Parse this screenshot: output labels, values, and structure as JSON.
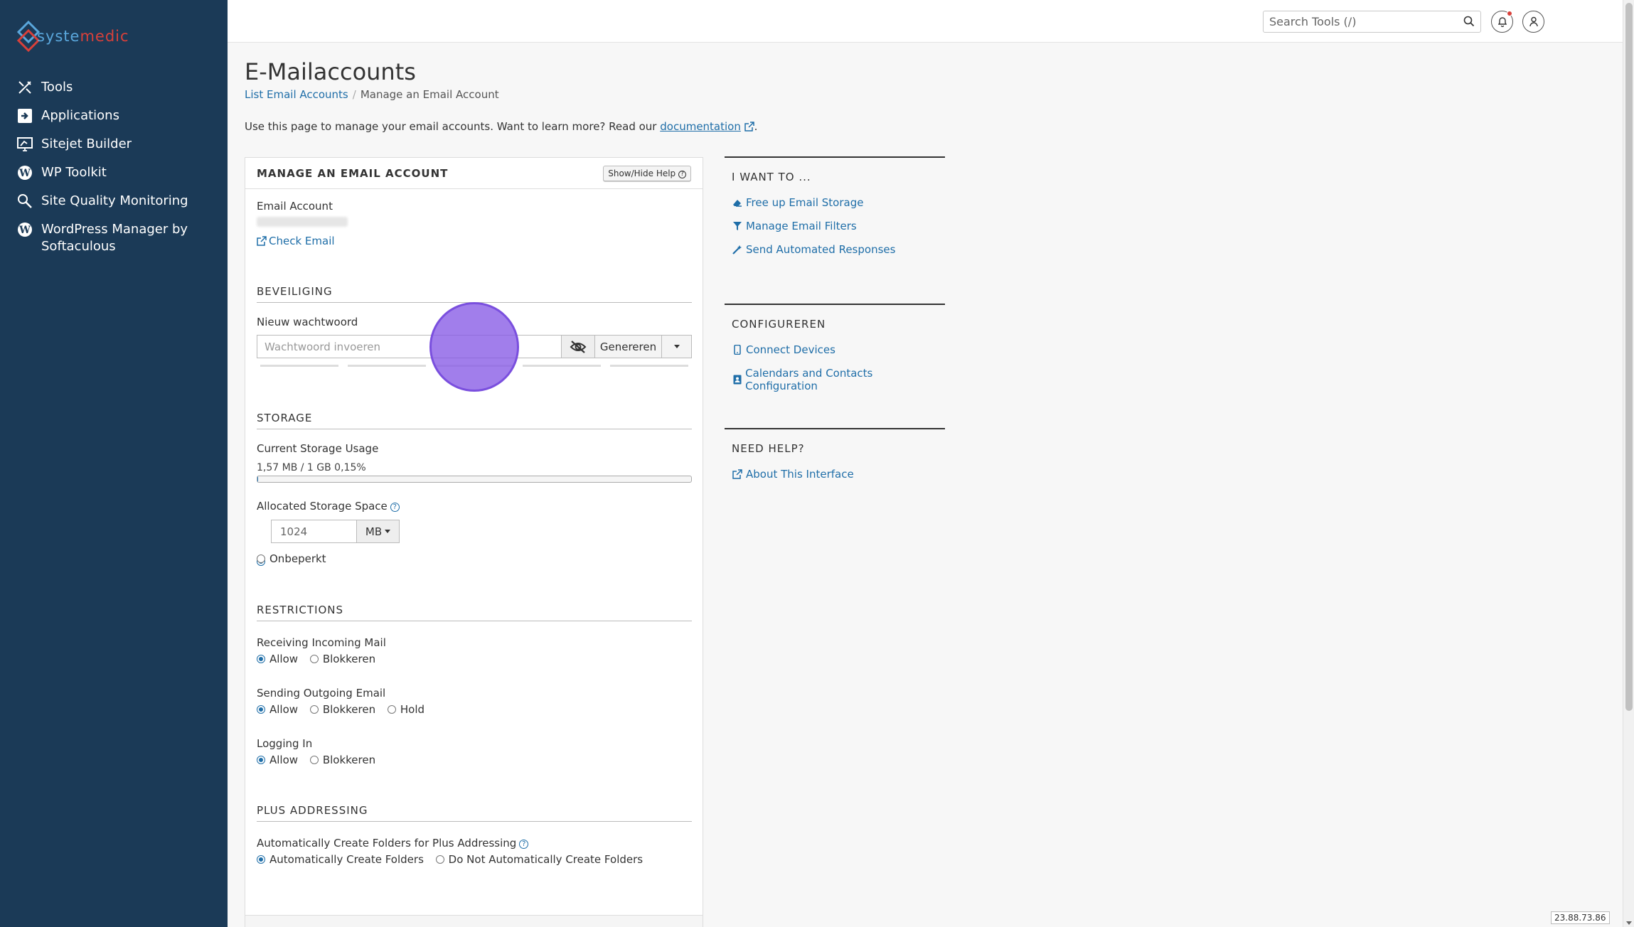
{
  "brand": {
    "logo_text_1": "syste",
    "logo_text_2": "medic",
    "accent": "#1f6ea8",
    "sidebar_bg": "#1b3a57"
  },
  "sidebar": {
    "items": [
      {
        "label": "Tools",
        "icon": "tools-icon"
      },
      {
        "label": "Applications",
        "icon": "applications-icon"
      },
      {
        "label": "Sitejet Builder",
        "icon": "sitejet-icon"
      },
      {
        "label": "WP Toolkit",
        "icon": "wordpress-icon"
      },
      {
        "label": "Site Quality Monitoring",
        "icon": "magnifier-icon"
      },
      {
        "label": "WordPress Manager by Softaculous",
        "icon": "wordpress-icon"
      }
    ]
  },
  "topbar": {
    "search_placeholder": "Search Tools (/)"
  },
  "page": {
    "title": "E-Mailaccounts",
    "breadcrumb": {
      "link": "List Email Accounts",
      "sep": "/",
      "current": "Manage an Email Account"
    },
    "intro_text": "Use this page to manage your email accounts. Want to learn more? Read our",
    "intro_link": "documentation",
    "intro_end": "."
  },
  "panel": {
    "title": "MANAGE AN EMAIL ACCOUNT",
    "help_button": "Show/Hide Help",
    "email_account_label": "Email Account",
    "check_email": "Check Email",
    "security": {
      "heading": "BEVEILIGING",
      "new_password_label": "Nieuw wachtwoord",
      "password_placeholder": "Wachtwoord invoeren",
      "generate_button": "Genereren"
    },
    "storage": {
      "heading": "STORAGE",
      "current_label": "Current Storage Usage",
      "usage_text": "1,57 MB / 1 GB 0,15%",
      "usage_percent": 0.15,
      "allocated_label": "Allocated Storage Space",
      "allocated_value": "1024",
      "unit": "MB",
      "unlimited_label": "Onbeperkt"
    },
    "restrictions": {
      "heading": "RESTRICTIONS",
      "incoming_label": "Receiving Incoming Mail",
      "outgoing_label": "Sending Outgoing Email",
      "login_label": "Logging In",
      "allow": "Allow",
      "block": "Blokkeren",
      "hold": "Hold"
    },
    "plus": {
      "heading": "PLUS ADDRESSING",
      "label": "Automatically Create Folders for Plus Addressing",
      "opt_auto": "Automatically Create Folders",
      "opt_no": "Do Not Automatically Create Folders"
    }
  },
  "right": {
    "want": {
      "heading": "I WANT TO ...",
      "links": [
        "Free up Email Storage",
        "Manage Email Filters",
        "Send Automated Responses"
      ]
    },
    "configure": {
      "heading": "CONFIGUREREN",
      "links": [
        "Connect Devices",
        "Calendars and Contacts Configuration"
      ]
    },
    "help": {
      "heading": "NEED HELP?",
      "links": [
        "About This Interface"
      ]
    }
  },
  "footer": {
    "ip": "23.88.73.86"
  }
}
